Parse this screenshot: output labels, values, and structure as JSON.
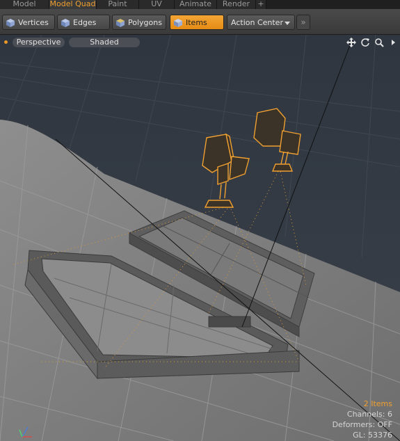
{
  "tabs": [
    {
      "label": "Model",
      "active": false
    },
    {
      "label": "Model Quad",
      "active": true
    },
    {
      "label": "Paint",
      "active": false
    },
    {
      "label": "UV",
      "active": false
    },
    {
      "label": "Animate",
      "active": false
    },
    {
      "label": "Render",
      "active": false
    },
    {
      "label": "+",
      "active": false
    }
  ],
  "toolbar": {
    "modes": [
      {
        "label": "Vertices",
        "icon": "vertex-cube-icon",
        "active": false
      },
      {
        "label": "Edges",
        "icon": "edge-cube-icon",
        "active": false
      },
      {
        "label": "Polygons",
        "icon": "polygon-cube-icon",
        "active": false
      },
      {
        "label": "Items",
        "icon": "item-cube-icon",
        "active": true
      }
    ],
    "action_center": "Action Center",
    "more": "»"
  },
  "viewport": {
    "projection": "Perspective",
    "shading": "Shaded",
    "icons": [
      "move-view-icon",
      "rotate-view-icon",
      "zoom-view-icon",
      "viewport-menu-icon"
    ]
  },
  "info": {
    "items": "2 Items",
    "channels": "Channels: 6",
    "deformers": "Deformers: OFF",
    "gl": "GL: 53376"
  },
  "colors": {
    "accent": "#f0a030",
    "selection": "#f0a030",
    "viewport_bg": "#333a42",
    "floor": "#7c7c7c"
  }
}
